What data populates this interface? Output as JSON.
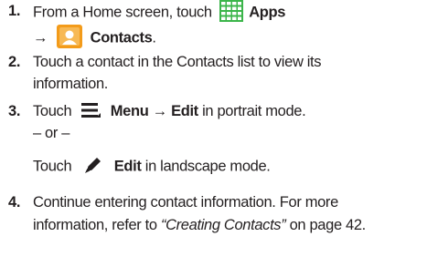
{
  "colors": {
    "text": "#231f20",
    "apps_icon": "#3bb54a",
    "contacts_icon": "#f39b1a"
  },
  "steps": [
    {
      "number": "1.",
      "line1_prefix": "From a Home screen, touch",
      "apps_icon": "apps-grid-icon",
      "apps_label": "Apps",
      "arrow": "→",
      "contacts_icon": "contacts-icon",
      "contacts_label": "Contacts",
      "period": "."
    },
    {
      "number": "2.",
      "line1": "Touch a contact in the Contacts list to view its",
      "line2": "information."
    },
    {
      "number": "3.",
      "prefix": "Touch",
      "menu_icon": "menu-icon",
      "menu_label": "Menu",
      "arrow": "→",
      "edit_label": "Edit",
      "suffix": "in portrait mode.",
      "or_text": "– or –",
      "alt_prefix": "Touch",
      "edit_icon": "pencil-icon",
      "alt_edit_label": "Edit",
      "alt_suffix": "in landscape mode."
    },
    {
      "number": "4.",
      "line1": "Continue entering contact information. For more",
      "line2_prefix": "information, refer to",
      "link_text": "“Creating Contacts”",
      "line2_suffix": " on page 42."
    }
  ]
}
